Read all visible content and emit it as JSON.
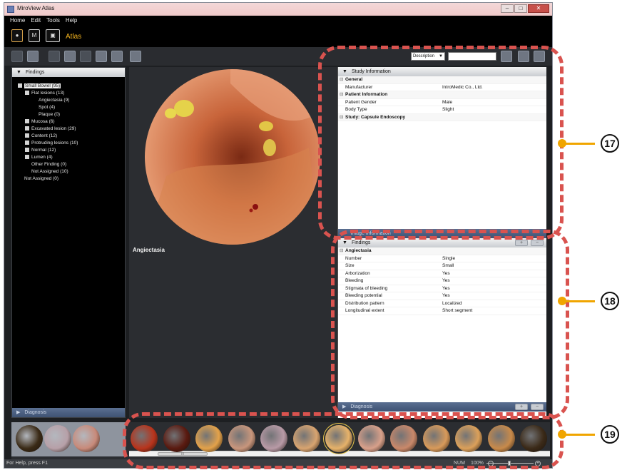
{
  "window": {
    "title": "MiroView Atlas",
    "buttons": [
      "–",
      "□",
      "✕"
    ]
  },
  "menu": [
    "Home",
    "Edit",
    "Tools",
    "Help"
  ],
  "mode": {
    "buttons": [
      "●",
      "M",
      "▣"
    ],
    "label": "Atlas"
  },
  "toolbar": {
    "search_select": "Description",
    "search_value": "",
    "icons": [
      "new-doc-icon",
      "add-doc-icon",
      "check-icon",
      "mail-icon",
      "find-icon",
      "print-icon",
      "export-icon",
      "pointer-icon"
    ],
    "right_icons": [
      "search-icon",
      "list-icon",
      "gear-icon"
    ]
  },
  "left_pane": {
    "header": "Findings",
    "tree": [
      {
        "label": "Small Bowel (95)",
        "level": 0,
        "expander": "−",
        "selected": true
      },
      {
        "label": "Flat lesions (13)",
        "level": 1,
        "expander": "−"
      },
      {
        "label": "Angiectasia (9)",
        "level": 2,
        "expander": ""
      },
      {
        "label": "Spot (4)",
        "level": 2,
        "expander": ""
      },
      {
        "label": "Plaque (0)",
        "level": 2,
        "expander": ""
      },
      {
        "label": "Mucosa (6)",
        "level": 1,
        "expander": "+"
      },
      {
        "label": "Excavated lesion (29)",
        "level": 1,
        "expander": "+"
      },
      {
        "label": "Content (12)",
        "level": 1,
        "expander": "+"
      },
      {
        "label": "Protruding lesions (10)",
        "level": 1,
        "expander": "+"
      },
      {
        "label": "Normal (12)",
        "level": 1,
        "expander": "+"
      },
      {
        "label": "Lumen (4)",
        "level": 1,
        "expander": "+"
      },
      {
        "label": "Other Finding (0)",
        "level": 1,
        "expander": ""
      },
      {
        "label": "Not Assigned (10)",
        "level": 1,
        "expander": ""
      },
      {
        "label": "Not Assigned (0)",
        "level": 0,
        "expander": ""
      }
    ],
    "footer": "Diagnosis"
  },
  "center_pane": {
    "caption": "Angiectasia"
  },
  "right_pane": {
    "study_header": "Study Information",
    "study_rows": [
      {
        "type": "section",
        "label": "General"
      },
      {
        "type": "row",
        "key": "Manufacturer",
        "value": "IntroMedic Co., Ltd."
      },
      {
        "type": "section",
        "label": "Patient Information"
      },
      {
        "type": "row",
        "key": "Patient Gender",
        "value": "Male"
      },
      {
        "type": "row",
        "key": "Body Type",
        "value": "Slight"
      },
      {
        "type": "section",
        "label": "Study: Capsule Endoscopy"
      }
    ],
    "image_info_header": "Image Information",
    "findings_header": "Findings",
    "findings_buttons": [
      "+",
      "−"
    ],
    "findings_rows": [
      {
        "type": "section",
        "label": "Angiectasia"
      },
      {
        "type": "row",
        "key": "Number",
        "value": "Single"
      },
      {
        "type": "row",
        "key": "Size",
        "value": "Small"
      },
      {
        "type": "row",
        "key": "Arborization",
        "value": "Yes"
      },
      {
        "type": "row",
        "key": "Bleeding",
        "value": "Yes"
      },
      {
        "type": "row",
        "key": "Stigmata of bleeding",
        "value": "Yes"
      },
      {
        "type": "row",
        "key": "Bleeding potential",
        "value": "Yes"
      },
      {
        "type": "row",
        "key": "Distribution pattern",
        "value": "Localized"
      },
      {
        "type": "row",
        "key": "Longitudinal extent",
        "value": "Short segment"
      }
    ],
    "diagnosis_header": "Diagnosis",
    "diagnosis_buttons": [
      "+",
      "−"
    ]
  },
  "strip": {
    "left_thumbs": [
      "#3a2a16",
      "#b7a0a8",
      "#c88a7a"
    ],
    "right_thumbs": [
      "#b8341c",
      "#5a1a10",
      "#e3a24a",
      "#c8967c",
      "#b89aa6",
      "#d8a470",
      "#e6b26a",
      "#d8a08a",
      "#c9886a",
      "#d89a5a",
      "#dba05a",
      "#c88a4a",
      "#3b2a18"
    ],
    "selected_index": 6,
    "scroll_label": "III"
  },
  "status": {
    "help": "For Help, press F1",
    "num": "NUM",
    "zoom": "100%"
  },
  "callouts": [
    "17",
    "18",
    "19"
  ]
}
